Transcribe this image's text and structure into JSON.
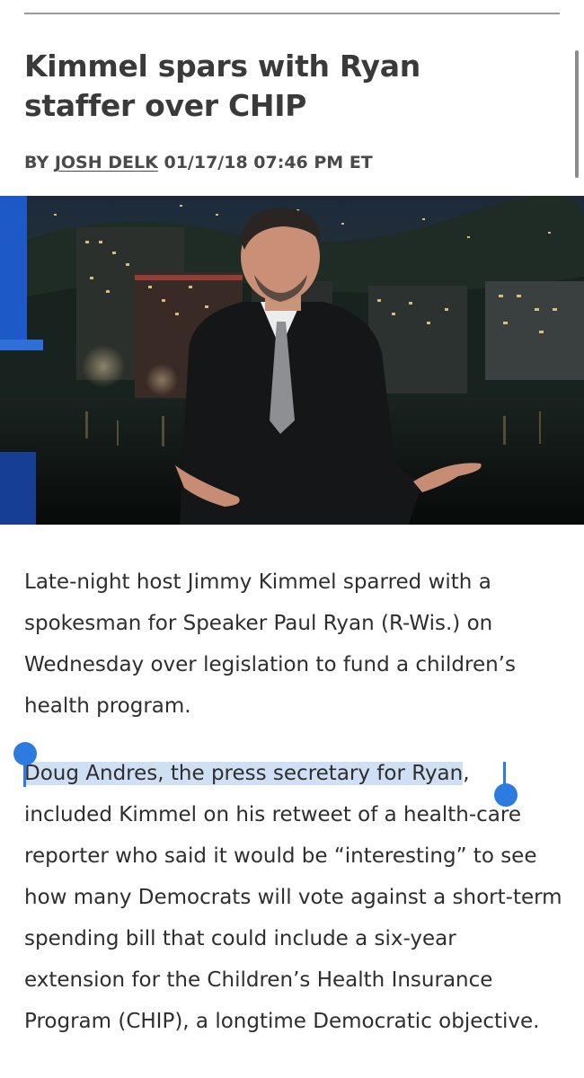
{
  "article": {
    "headline": "Kimmel spars with Ryan staffer over CHIP",
    "byline_prefix": "BY",
    "author": "JOSH DELK",
    "timestamp": "01/17/18 07:46 PM ET",
    "paragraph1": "Late-night host Jimmy Kimmel sparred with a spokesman for Speaker Paul Ryan (R-Wis.) on Wednesday over legislation to fund a children’s health program.",
    "paragraph2_selected": "Doug Andres, the press secretary for Ryan",
    "paragraph2_rest": ", included Kimmel on his retweet of a health-care reporter who said it would be “interesting” to see how many Democrats will vote against a short-term spending bill that  could include a six-year extension for the Children’s Health Insurance Program (CHIP), a longtime Democratic objective."
  },
  "colors": {
    "selection_highlight": "#cfe0f5",
    "selection_handle": "#2d7be0",
    "headline_text": "#3a3a3a"
  },
  "icons": {
    "selection_start": "selection-start-handle",
    "selection_end": "selection-end-handle"
  }
}
